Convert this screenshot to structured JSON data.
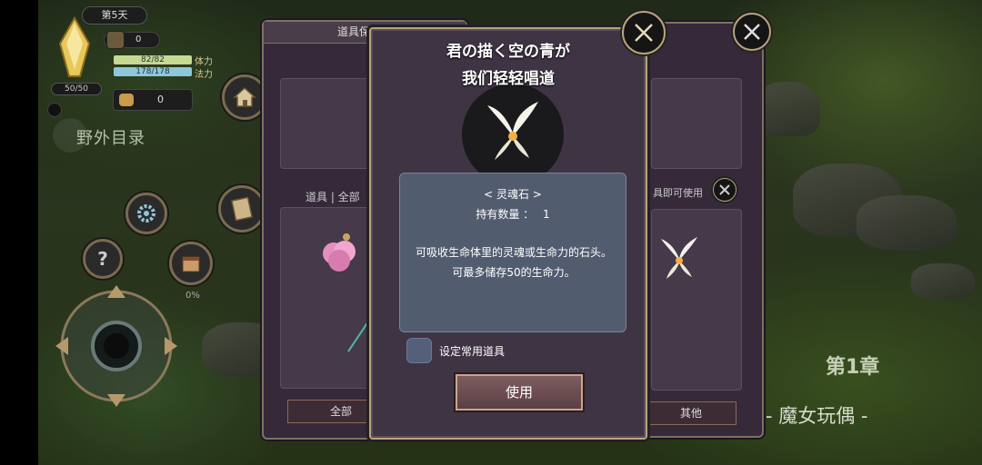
{
  "hud": {
    "day": "第5天",
    "hp": "50/50",
    "counter": "0",
    "stamina": "82/82",
    "stamina_label": "体力",
    "mana": "178/178",
    "mana_label": "法力",
    "gold": "0",
    "wild_directory": "野外目录",
    "help": "?",
    "calendar_percent": "0%"
  },
  "chapter": {
    "title": "第1章",
    "subtitle": "- 魔女玩偶 -"
  },
  "left_panel": {
    "title": "道具保管箱",
    "tab": "道具 | 全部",
    "bottom_tab": "全部"
  },
  "right_panel": {
    "hint": "具即可使用",
    "bottom_tab": "其他"
  },
  "dialog": {
    "lyric_line1": "君の描く空の青が",
    "lyric_line2": "我们轻轻唱道",
    "item_name": "< 灵魂石 >",
    "quantity_label": "持有数量 ：",
    "quantity_value": "1",
    "description": "可吸收生命体里的灵魂或生命力的石头。可最多储存50的生命力。",
    "checkbox_label": "设定常用道具",
    "use_button": "使用"
  },
  "colors": {
    "dialog_bg": "#3f3444",
    "frame_gold": "#b9a37b",
    "desc_bg": "#515c6f",
    "button_bg": "#6d4f53"
  },
  "icons": [
    "crystal-icon",
    "coin-bag-icon",
    "home-icon",
    "gear-icon",
    "book-icon",
    "calendar-icon",
    "soul-stone-icon",
    "pink-flower-icon",
    "close-icon",
    "joystick"
  ]
}
